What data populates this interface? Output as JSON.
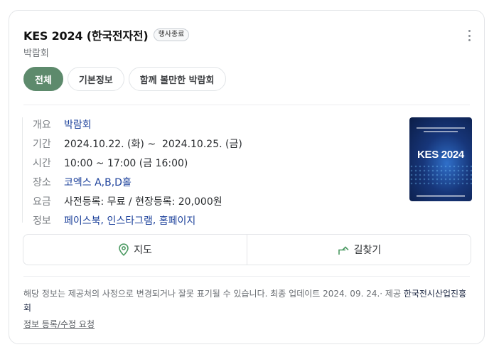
{
  "header": {
    "title": "KES 2024 (한국전자전)",
    "badge": "행사종료",
    "subtitle": "박람회"
  },
  "tabs": [
    {
      "label": "전체",
      "active": true
    },
    {
      "label": "기본정보",
      "active": false
    },
    {
      "label": "함께 볼만한 박람회",
      "active": false
    }
  ],
  "info": {
    "category": {
      "key": "개요",
      "value": "박람회"
    },
    "period": {
      "key": "기간",
      "value": "2024.10.22. (화) ~  2024.10.25. (금)"
    },
    "time": {
      "key": "시간",
      "value": "10:00 ~ 17:00 (금 16:00)"
    },
    "place": {
      "key": "장소",
      "value": "코엑스 A,B,D홀"
    },
    "fee": {
      "key": "요금",
      "value": "사전등록: 무료 / 현장등록: 20,000원"
    },
    "links": {
      "key": "정보",
      "items": [
        "페이스북",
        "인스타그램",
        "홈페이지"
      ],
      "sep": ", "
    }
  },
  "poster": {
    "text": "KES 2024"
  },
  "actions": {
    "map": {
      "label": "지도",
      "icon": "map-pin-icon"
    },
    "directions": {
      "label": "길찾기",
      "icon": "directions-arrow-icon"
    }
  },
  "notice": {
    "text": "해당 정보는 제공처의 사정으로 변경되거나 잘못 표기될 수 있습니다. 최종 업데이트 2024. 09. 24.· 제공 ",
    "provider": "한국전시산업진흥회"
  },
  "edit_link": "정보 등록/수정 요청",
  "colors": {
    "accent": "#5d8a6c",
    "link": "#1a3f9a"
  }
}
